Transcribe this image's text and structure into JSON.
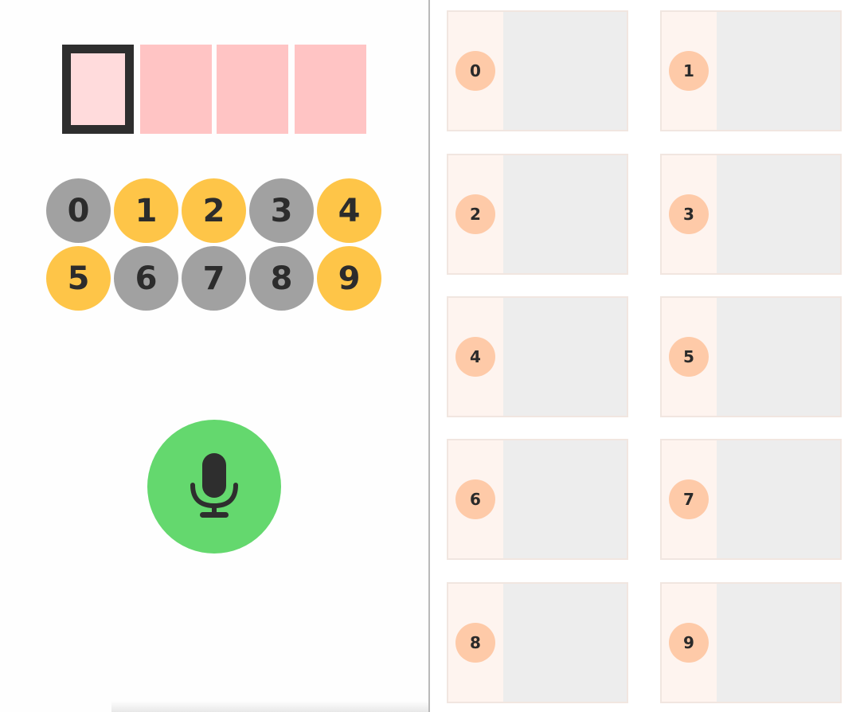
{
  "code": {
    "active_index": 0,
    "slots": 4
  },
  "keypad": {
    "keys": [
      {
        "label": "0",
        "state": "used"
      },
      {
        "label": "1",
        "state": "available"
      },
      {
        "label": "2",
        "state": "available"
      },
      {
        "label": "3",
        "state": "used"
      },
      {
        "label": "4",
        "state": "available"
      },
      {
        "label": "5",
        "state": "available"
      },
      {
        "label": "6",
        "state": "used"
      },
      {
        "label": "7",
        "state": "used"
      },
      {
        "label": "8",
        "state": "used"
      },
      {
        "label": "9",
        "state": "available"
      }
    ]
  },
  "mic": {
    "icon": "microphone-icon"
  },
  "cards": [
    {
      "label": "0"
    },
    {
      "label": "1"
    },
    {
      "label": "2"
    },
    {
      "label": "3"
    },
    {
      "label": "4"
    },
    {
      "label": "5"
    },
    {
      "label": "6"
    },
    {
      "label": "7"
    },
    {
      "label": "8"
    },
    {
      "label": "9"
    }
  ],
  "colors": {
    "slot_empty": "#ffc4c4",
    "slot_active": "#ffdbdc",
    "slot_active_border": "#2e2e2e",
    "key_available": "#fec548",
    "key_used": "#a1a1a1",
    "mic_background": "#64d86e",
    "mic_icon": "#2e2e2e",
    "card_badge": "#fecaa8",
    "card_side": "#fef4ef",
    "card_body": "#ededed"
  }
}
